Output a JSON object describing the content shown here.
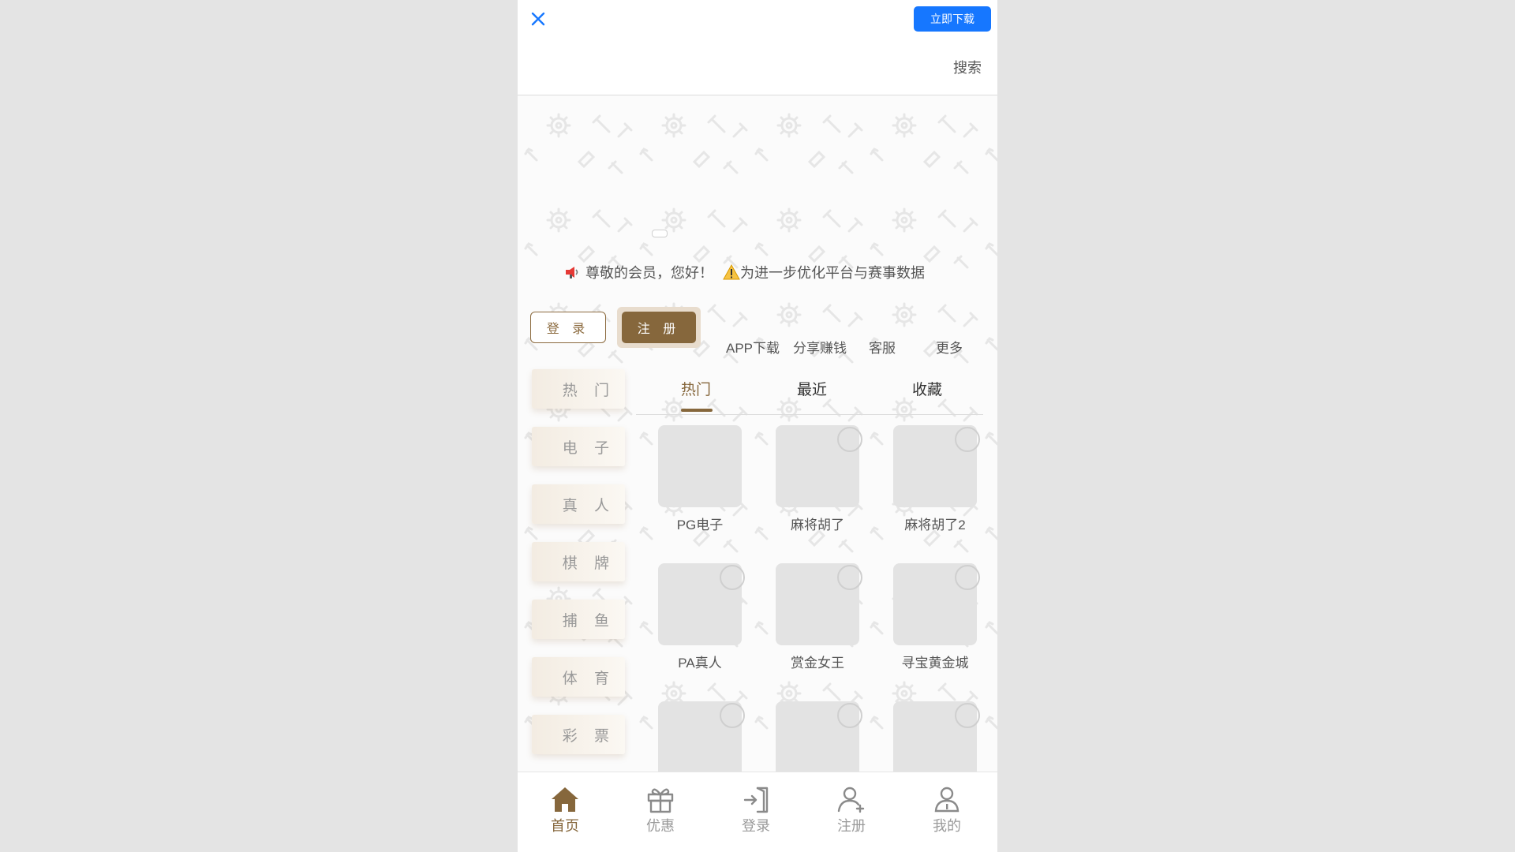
{
  "header": {
    "download_label": "立即下载",
    "search_label": "搜索"
  },
  "notice": {
    "text_1": "尊敬的会员，您好！",
    "text_2": "为进一步优化平台与赛事数据"
  },
  "auth": {
    "login_label": "登 录",
    "register_label": "注 册"
  },
  "quicklinks": [
    "APP下载",
    "分享赚钱",
    "客服",
    "更多"
  ],
  "categories": [
    "热 门",
    "电 子",
    "真 人",
    "棋 牌",
    "捕 鱼",
    "体 育",
    "彩 票"
  ],
  "tabs": [
    "热门",
    "最近",
    "收藏"
  ],
  "active_tab": "热门",
  "games": [
    "PG电子",
    "麻将胡了",
    "麻将胡了2",
    "PA真人",
    "赏金女王",
    "寻宝黄金城",
    "",
    "",
    ""
  ],
  "bottom_nav": [
    "首页",
    "优惠",
    "登录",
    "注册",
    "我的"
  ],
  "active_nav": "首页",
  "colors": {
    "brand": "#86673c",
    "download_blue": "#1677ff",
    "close_blue": "#1677ff"
  }
}
